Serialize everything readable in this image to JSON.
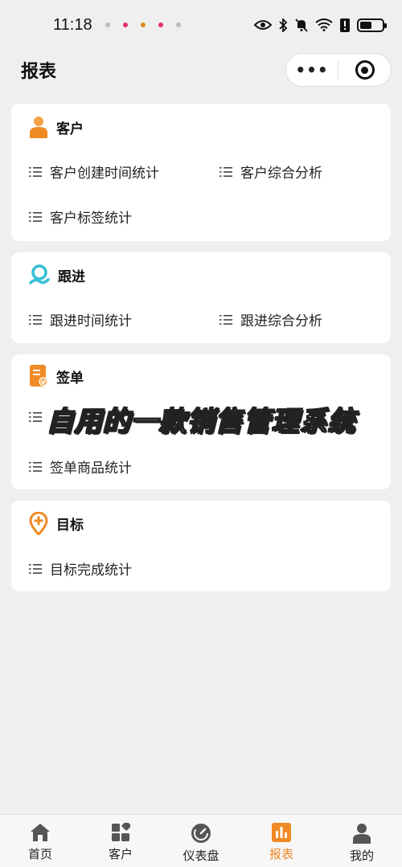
{
  "status_bar": {
    "time": "11:18",
    "notification_dot_colors": [
      "#bbbbbb",
      "#e0306a",
      "#e08a1a",
      "#e0306a",
      "#bbbbbb"
    ],
    "icons": [
      "eye-icon",
      "bluetooth-icon",
      "mute-icon",
      "wifi-icon",
      "alert-icon",
      "battery-icon"
    ],
    "wifi_label": "6"
  },
  "header": {
    "title": "报表",
    "more_label": "•••"
  },
  "sections": {
    "customer": {
      "title": "客户",
      "icon": "person-icon",
      "items": [
        "客户创建时间统计",
        "客户综合分析",
        "客户标签统计"
      ]
    },
    "followup": {
      "title": "跟进",
      "icon": "followup-icon",
      "items": [
        "跟进时间统计",
        "跟进综合分析"
      ]
    },
    "order": {
      "title": "签单",
      "icon": "document-icon",
      "items": [
        "签单商品统计"
      ]
    },
    "goal": {
      "title": "目标",
      "icon": "location-pin-icon",
      "items": [
        "目标完成统计"
      ]
    }
  },
  "watermark": "自用的一款销售管理系统",
  "tabbar": {
    "active": "报表",
    "tabs": [
      {
        "label": "首页",
        "icon": "home-icon"
      },
      {
        "label": "客户",
        "icon": "grid-icon"
      },
      {
        "label": "仪表盘",
        "icon": "dashboard-icon"
      },
      {
        "label": "报表",
        "icon": "bar-chart-icon"
      },
      {
        "label": "我的",
        "icon": "user-icon"
      }
    ]
  },
  "colors": {
    "accent": "#f08a24",
    "teal": "#35bfd5",
    "background": "#efefef"
  }
}
